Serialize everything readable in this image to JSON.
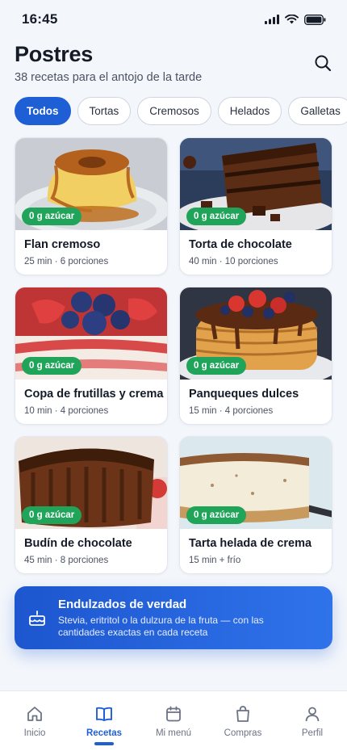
{
  "status": {
    "time": "16:45"
  },
  "header": {
    "title": "Postres",
    "subtitle": "38 recetas para el antojo de la tarde",
    "search_icon": "search-icon"
  },
  "filters": [
    {
      "label": "Todos",
      "active": true
    },
    {
      "label": "Tortas",
      "active": false
    },
    {
      "label": "Cremosos",
      "active": false
    },
    {
      "label": "Helados",
      "active": false
    },
    {
      "label": "Galletas",
      "active": false
    }
  ],
  "recipes": [
    {
      "title": "Flan cremoso",
      "meta": "25 min · 6 porciones",
      "badge": "0 g azúcar"
    },
    {
      "title": "Torta de chocolate",
      "meta": "40 min · 10 porciones",
      "badge": "0 g azúcar"
    },
    {
      "title": "Copa de frutillas y crema",
      "meta": "10 min · 4 porciones",
      "badge": "0 g azúcar"
    },
    {
      "title": "Panqueques dulces",
      "meta": "15 min · 4 porciones",
      "badge": "0 g azúcar"
    },
    {
      "title": "Budín de chocolate",
      "meta": "45 min · 8 porciones",
      "badge": "0 g azúcar"
    },
    {
      "title": "Tarta helada de crema",
      "meta": "15 min + frío",
      "badge": "0 g azúcar"
    }
  ],
  "promo": {
    "title": "Endulzados de verdad",
    "text": "Stevia, eritritol o la dulzura de la fruta — con las cantidades exactas en cada receta",
    "icon": "cake-icon"
  },
  "tabs": [
    {
      "label": "Inicio",
      "icon": "home-icon",
      "active": false
    },
    {
      "label": "Recetas",
      "icon": "book-icon",
      "active": true
    },
    {
      "label": "Mi menú",
      "icon": "calendar-icon",
      "active": false
    },
    {
      "label": "Compras",
      "icon": "bag-icon",
      "active": false
    },
    {
      "label": "Perfil",
      "icon": "user-icon",
      "active": false
    }
  ],
  "colors": {
    "accent": "#1f5fd6",
    "badge": "#1fa45a",
    "background": "#f3f6fb"
  }
}
